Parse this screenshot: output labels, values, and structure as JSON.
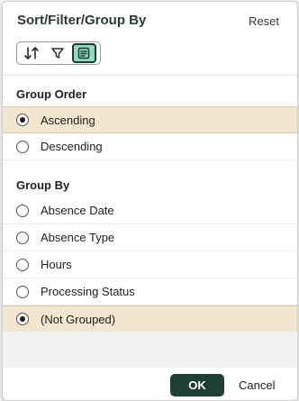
{
  "dialog": {
    "title": "Sort/Filter/Group By",
    "reset_label": "Reset"
  },
  "mode_buttons": [
    {
      "icon": "sort-icon"
    },
    {
      "icon": "filter-icon"
    },
    {
      "icon": "group-by-icon",
      "active": true
    }
  ],
  "group_order": {
    "title": "Group Order",
    "options": [
      {
        "label": "Ascending",
        "selected": true
      },
      {
        "label": "Descending",
        "selected": false
      }
    ]
  },
  "group_by": {
    "title": "Group By",
    "options": [
      {
        "label": "Absence Date",
        "selected": false
      },
      {
        "label": "Absence Type",
        "selected": false
      },
      {
        "label": "Hours",
        "selected": false
      },
      {
        "label": "Processing Status",
        "selected": false
      },
      {
        "label": "(Not Grouped)",
        "selected": true
      }
    ]
  },
  "footer": {
    "ok_label": "OK",
    "cancel_label": "Cancel"
  },
  "colors": {
    "selected_row": "#f3e6cf",
    "primary_button": "#1e3f33",
    "active_mode": "#8fd9c5"
  }
}
